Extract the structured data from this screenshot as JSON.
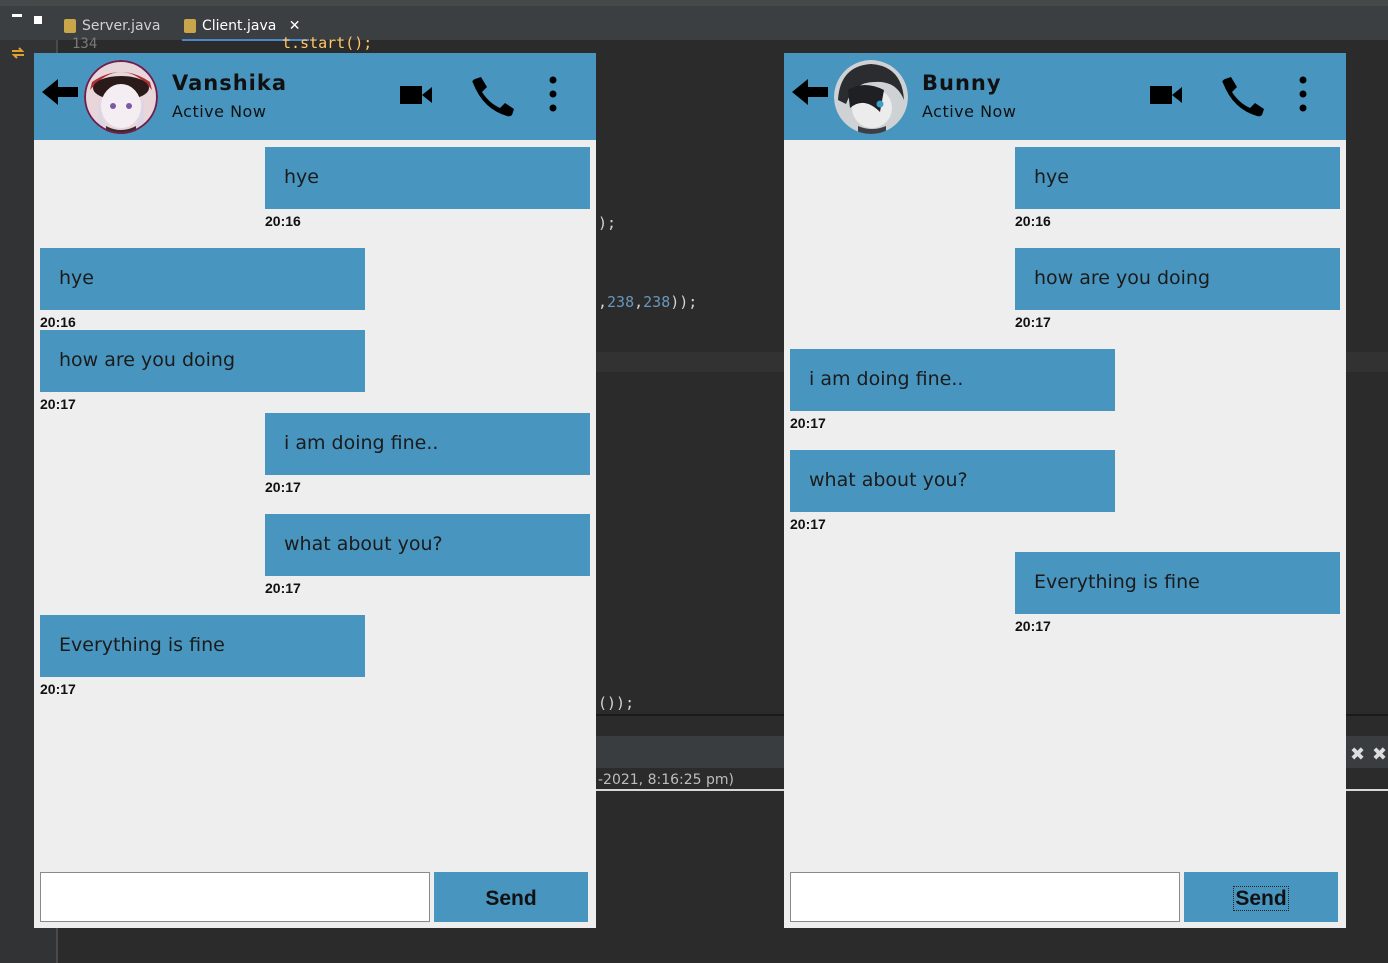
{
  "ide": {
    "tabs": [
      {
        "label": "Server.java"
      },
      {
        "label": "Client.java"
      }
    ],
    "close_glyph": "✕",
    "line_number": "134",
    "code_lines": {
      "l1": "t.start();",
      "l2": ");",
      "l3_prefix": ",",
      "l3_n1": "238",
      "l3_mid": ",",
      "l3_n2": "238",
      "l3_suffix": "));",
      "l4": "());"
    },
    "console_text": "-2021, 8:16:25 pm)",
    "console_icons": [
      "close-icon",
      "close-all-icon"
    ]
  },
  "chats": [
    {
      "contact_name": "Vanshika",
      "status": "Active Now",
      "avatar": "anime-girl-avatar",
      "icons": [
        "back-arrow-icon",
        "video-camera-icon",
        "phone-icon",
        "more-vertical-icon"
      ],
      "messages": [
        {
          "text": "hye",
          "time": "20:16",
          "side": "right"
        },
        {
          "text": "hye",
          "time": "20:16",
          "side": "left"
        },
        {
          "text": "how are you doing",
          "time": "20:17",
          "side": "left"
        },
        {
          "text": "i am doing fine..",
          "time": "20:17",
          "side": "right"
        },
        {
          "text": "what about you?",
          "time": "20:17",
          "side": "right"
        },
        {
          "text": "Everything is fine",
          "time": "20:17",
          "side": "left"
        }
      ],
      "input_value": "",
      "send_label": "Send"
    },
    {
      "contact_name": "Bunny",
      "status": "Active Now",
      "avatar": "anime-boy-avatar",
      "icons": [
        "back-arrow-icon",
        "video-camera-icon",
        "phone-icon",
        "more-vertical-icon"
      ],
      "messages": [
        {
          "text": "hye",
          "time": "20:16",
          "side": "right"
        },
        {
          "text": "how are you doing",
          "time": "20:17",
          "side": "right"
        },
        {
          "text": "i am doing fine..",
          "time": "20:17",
          "side": "left"
        },
        {
          "text": "what about you?",
          "time": "20:17",
          "side": "left"
        },
        {
          "text": "Everything is fine",
          "time": "20:17",
          "side": "right"
        }
      ],
      "input_value": "",
      "send_label": "Send"
    }
  ],
  "colors": {
    "header": "#4896c0",
    "bubble": "#4896c0",
    "chat_bg": "#eeeeee",
    "ide_bg": "#2b2b2b"
  }
}
